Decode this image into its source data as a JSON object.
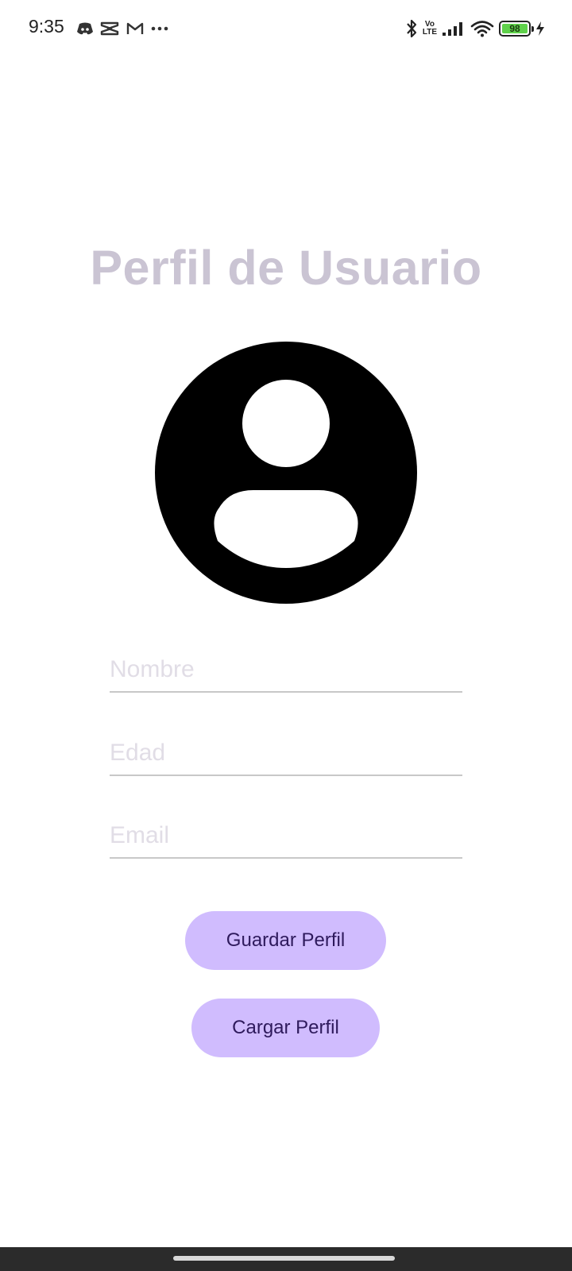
{
  "status_bar": {
    "time": "9:35",
    "left_icons": [
      "discord-icon",
      "capcut-icon",
      "gmail-icon",
      "more-dots-icon"
    ],
    "right_icons": [
      "bluetooth-icon",
      "volte-icon",
      "signal-icon",
      "wifi-icon",
      "battery-icon",
      "charging-icon"
    ],
    "volte_line1": "Vo",
    "volte_line2": "LTE",
    "battery_level": "98",
    "battery_color": "#5fd14b"
  },
  "profile": {
    "title": "Perfil de Usuario",
    "avatar_icon": "account-circle-icon",
    "fields": {
      "name_placeholder": "Nombre",
      "name_value": "",
      "age_placeholder": "Edad",
      "age_value": "",
      "email_placeholder": "Email",
      "email_value": ""
    },
    "buttons": {
      "save_label": "Guardar Perfil",
      "load_label": "Cargar Perfil"
    }
  },
  "colors": {
    "title": "#cac4d3",
    "button_bg": "#d0bcfe",
    "button_text": "#2e1a5c",
    "underline": "#c8c8c8",
    "placeholder": "#e1dde6",
    "nav_bar": "#2b2b2b"
  }
}
